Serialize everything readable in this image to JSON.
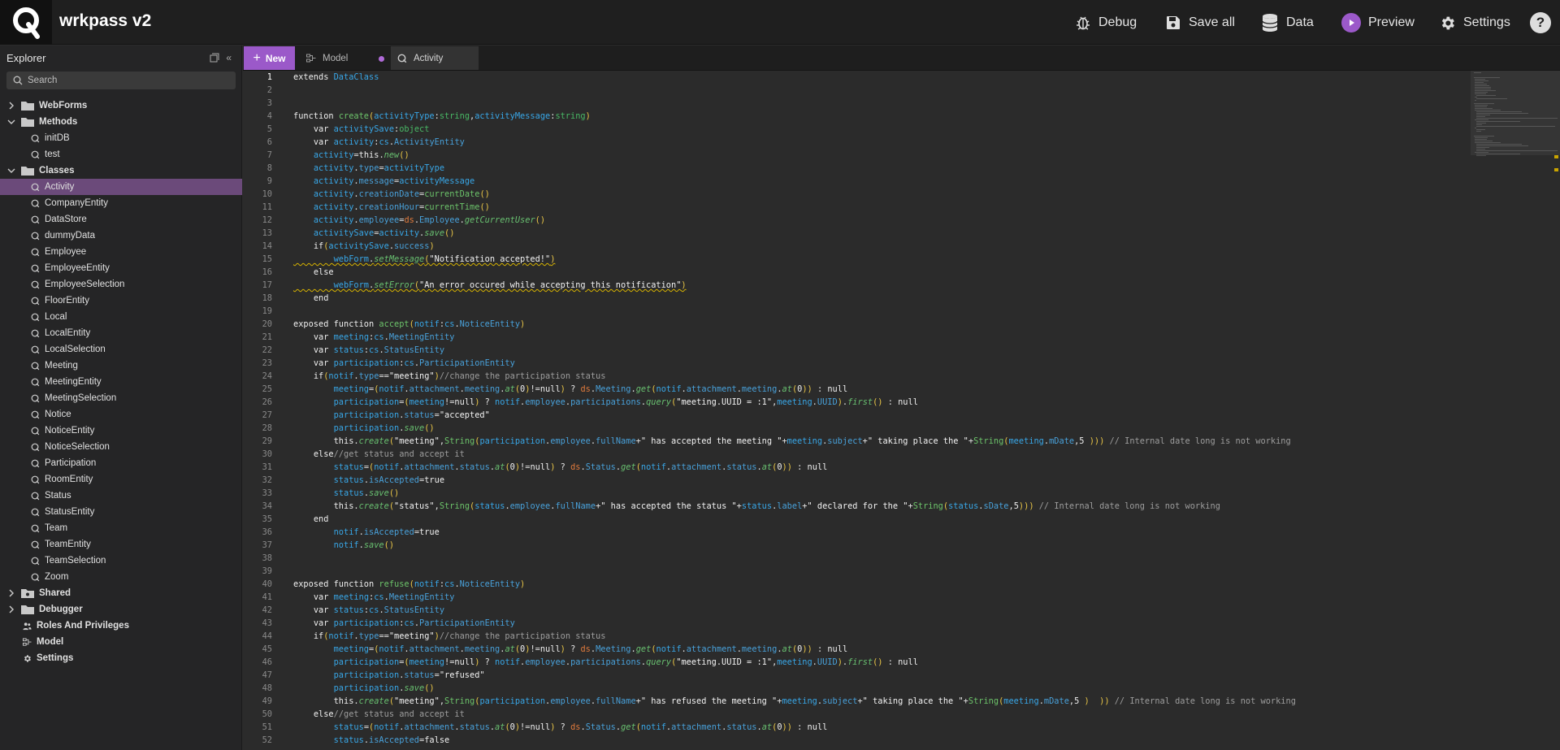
{
  "app": {
    "title": "wrkpass v2"
  },
  "toolbar": {
    "debug_label": "Debug",
    "save_all_label": "Save all",
    "data_label": "Data",
    "preview_label": "Preview",
    "settings_label": "Settings",
    "help_label": "?"
  },
  "sidebar": {
    "title": "Explorer",
    "search_placeholder": "Search",
    "tree": [
      {
        "label": "WebForms",
        "icon": "folder-icon",
        "level": 0,
        "expanded": false
      },
      {
        "label": "Methods",
        "icon": "folder-icon",
        "level": 0,
        "expanded": true
      },
      {
        "label": "initDB",
        "icon": "method-icon",
        "level": 1
      },
      {
        "label": "test",
        "icon": "method-icon",
        "level": 1
      },
      {
        "label": "Classes",
        "icon": "folder-icon",
        "level": 0,
        "expanded": true
      },
      {
        "label": "Activity",
        "icon": "class-icon",
        "level": 1,
        "selected": true
      },
      {
        "label": "CompanyEntity",
        "icon": "class-icon",
        "level": 1
      },
      {
        "label": "DataStore",
        "icon": "class-icon",
        "level": 1
      },
      {
        "label": "dummyData",
        "icon": "class-icon",
        "level": 1
      },
      {
        "label": "Employee",
        "icon": "class-icon",
        "level": 1
      },
      {
        "label": "EmployeeEntity",
        "icon": "class-icon",
        "level": 1
      },
      {
        "label": "EmployeeSelection",
        "icon": "class-icon",
        "level": 1
      },
      {
        "label": "FloorEntity",
        "icon": "class-icon",
        "level": 1
      },
      {
        "label": "Local",
        "icon": "class-icon",
        "level": 1
      },
      {
        "label": "LocalEntity",
        "icon": "class-icon",
        "level": 1
      },
      {
        "label": "LocalSelection",
        "icon": "class-icon",
        "level": 1
      },
      {
        "label": "Meeting",
        "icon": "class-icon",
        "level": 1
      },
      {
        "label": "MeetingEntity",
        "icon": "class-icon",
        "level": 1
      },
      {
        "label": "MeetingSelection",
        "icon": "class-icon",
        "level": 1
      },
      {
        "label": "Notice",
        "icon": "class-icon",
        "level": 1
      },
      {
        "label": "NoticeEntity",
        "icon": "class-icon",
        "level": 1
      },
      {
        "label": "NoticeSelection",
        "icon": "class-icon",
        "level": 1
      },
      {
        "label": "Participation",
        "icon": "class-icon",
        "level": 1
      },
      {
        "label": "RoomEntity",
        "icon": "class-icon",
        "level": 1
      },
      {
        "label": "Status",
        "icon": "class-icon",
        "level": 1
      },
      {
        "label": "StatusEntity",
        "icon": "class-icon",
        "level": 1
      },
      {
        "label": "Team",
        "icon": "class-icon",
        "level": 1
      },
      {
        "label": "TeamEntity",
        "icon": "class-icon",
        "level": 1
      },
      {
        "label": "TeamSelection",
        "icon": "class-icon",
        "level": 1
      },
      {
        "label": "Zoom",
        "icon": "class-icon",
        "level": 1
      },
      {
        "label": "Shared",
        "icon": "shared-folder-icon",
        "level": 0,
        "expanded": false
      },
      {
        "label": "Debugger",
        "icon": "folder-icon",
        "level": 0,
        "expanded": false
      },
      {
        "label": "Roles And Privileges",
        "icon": "roles-icon",
        "level": 0
      },
      {
        "label": "Model",
        "icon": "model-icon",
        "level": 0
      },
      {
        "label": "Settings",
        "icon": "gear-icon",
        "level": 0
      }
    ]
  },
  "tabs": {
    "new_label": "New",
    "model_label": "Model",
    "activity_label": "Activity"
  },
  "editor": {
    "current_line": 1,
    "lines": [
      "extends DataClass",
      "",
      "",
      "function create(activityType:string,activityMessage:string)",
      "    var activitySave:object",
      "    var activity:cs.ActivityEntity",
      "    activity=this.new()",
      "    activity.type=activityType",
      "    activity.message=activityMessage",
      "    activity.creationDate=currentDate()",
      "    activity.creationHour=currentTime()",
      "    activity.employee=ds.Employee.getCurrentUser()",
      "    activitySave=activity.save()",
      "    if(activitySave.success)",
      "        webForm.setMessage(\"Notification accepted!\")",
      "    else",
      "        webForm.setError(\"An error occured while accepting this notification\")",
      "    end",
      "",
      "exposed function accept(notif:cs.NoticeEntity)",
      "    var meeting:cs.MeetingEntity",
      "    var status:cs.StatusEntity",
      "    var participation:cs.ParticipationEntity",
      "    if(notif.type==\"meeting\")//change the participation status",
      "        meeting=(notif.attachment.meeting.at(0)!=null) ? ds.Meeting.get(notif.attachment.meeting.at(0)) : null",
      "        participation=(meeting!=null) ? notif.employee.participations.query(\"meeting.UUID = :1\",meeting.UUID).first() : null",
      "        participation.status=\"accepted\"",
      "        participation.save()",
      "        this.create(\"meeting\",String(participation.employee.fullName+\" has accepted the meeting \"+meeting.subject+\" taking place the \"+String(meeting.mDate,5 ))) // Internal date long is not working",
      "    else//get status and accept it",
      "        status=(notif.attachment.status.at(0)!=null) ? ds.Status.get(notif.attachment.status.at(0)) : null",
      "        status.isAccepted=true",
      "        status.save()",
      "        this.create(\"status\",String(status.employee.fullName+\" has accepted the status \"+status.label+\" declared for the \"+String(status.sDate,5))) // Internal date long is not working",
      "    end",
      "        notif.isAccepted=true",
      "        notif.save()",
      "",
      "",
      "exposed function refuse(notif:cs.NoticeEntity)",
      "    var meeting:cs.MeetingEntity",
      "    var status:cs.StatusEntity",
      "    var participation:cs.ParticipationEntity",
      "    if(notif.type==\"meeting\")//change the participation status",
      "        meeting=(notif.attachment.meeting.at(0)!=null) ? ds.Meeting.get(notif.attachment.meeting.at(0)) : null",
      "        participation=(meeting!=null) ? notif.employee.participations.query(\"meeting.UUID = :1\",meeting.UUID).first() : null",
      "        participation.status=\"refused\"",
      "        participation.save()",
      "        this.create(\"meeting\",String(participation.employee.fullName+\" has refused the meeting \"+meeting.subject+\" taking place the \"+String(meeting.mDate,5 )  )) // Internal date long is not working",
      "    else//get status and accept it",
      "        status=(notif.attachment.status.at(0)!=null) ? ds.Status.get(notif.attachment.status.at(0)) : null",
      "        status.isAccepted=false"
    ]
  },
  "colors": {
    "accent": "#9b59c9",
    "selected_row": "#6b4a7a",
    "background": "#2b2b2b",
    "topbar": "#1f1f1f"
  }
}
